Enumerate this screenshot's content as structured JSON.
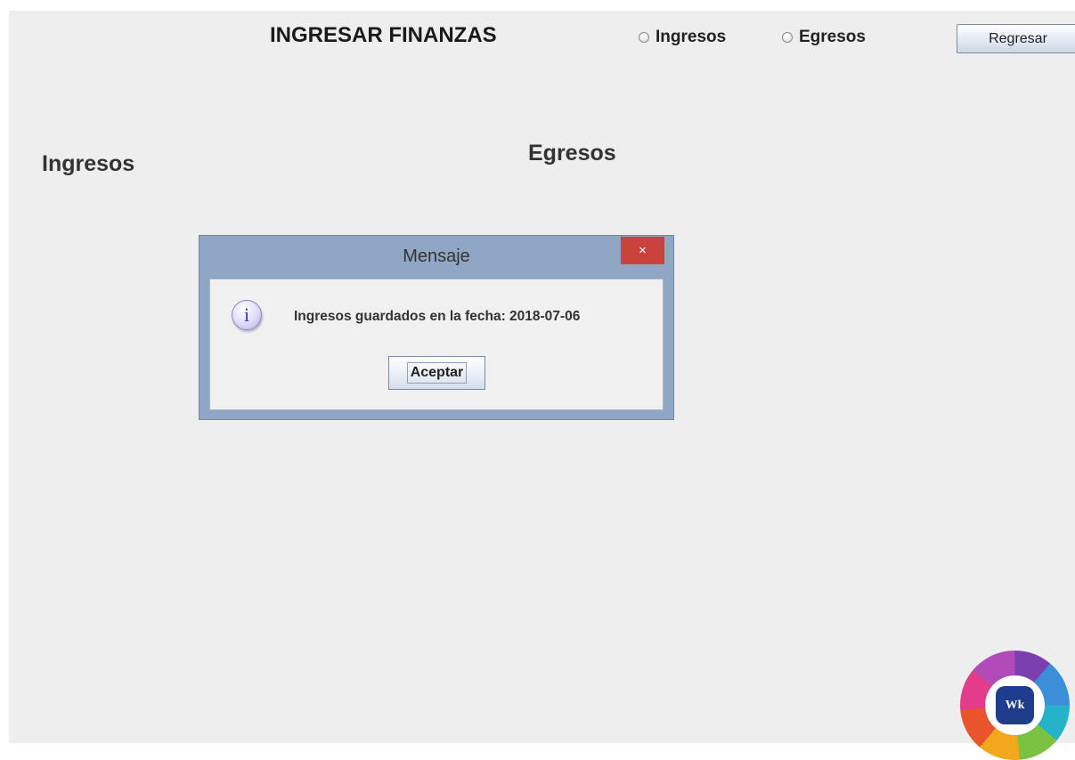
{
  "header": {
    "title": "INGRESAR FINANZAS",
    "radio_options": [
      "Ingresos",
      "Egresos"
    ],
    "back_button_label": "Regresar"
  },
  "content": {
    "ingresos_label": "Ingresos",
    "egresos_label": "Egresos"
  },
  "dialog": {
    "title": "Mensaje",
    "close_glyph": "×",
    "info_glyph": "i",
    "message": "Ingresos guardados en la fecha: 2018-07-06",
    "ok_label": "Aceptar"
  },
  "logo": {
    "text": "Wk"
  },
  "colors": {
    "window_bg": "#eeeeee",
    "dialog_frame": "#8fa6c4",
    "close_button": "#c7433c",
    "info_icon": "#b3afe8"
  }
}
